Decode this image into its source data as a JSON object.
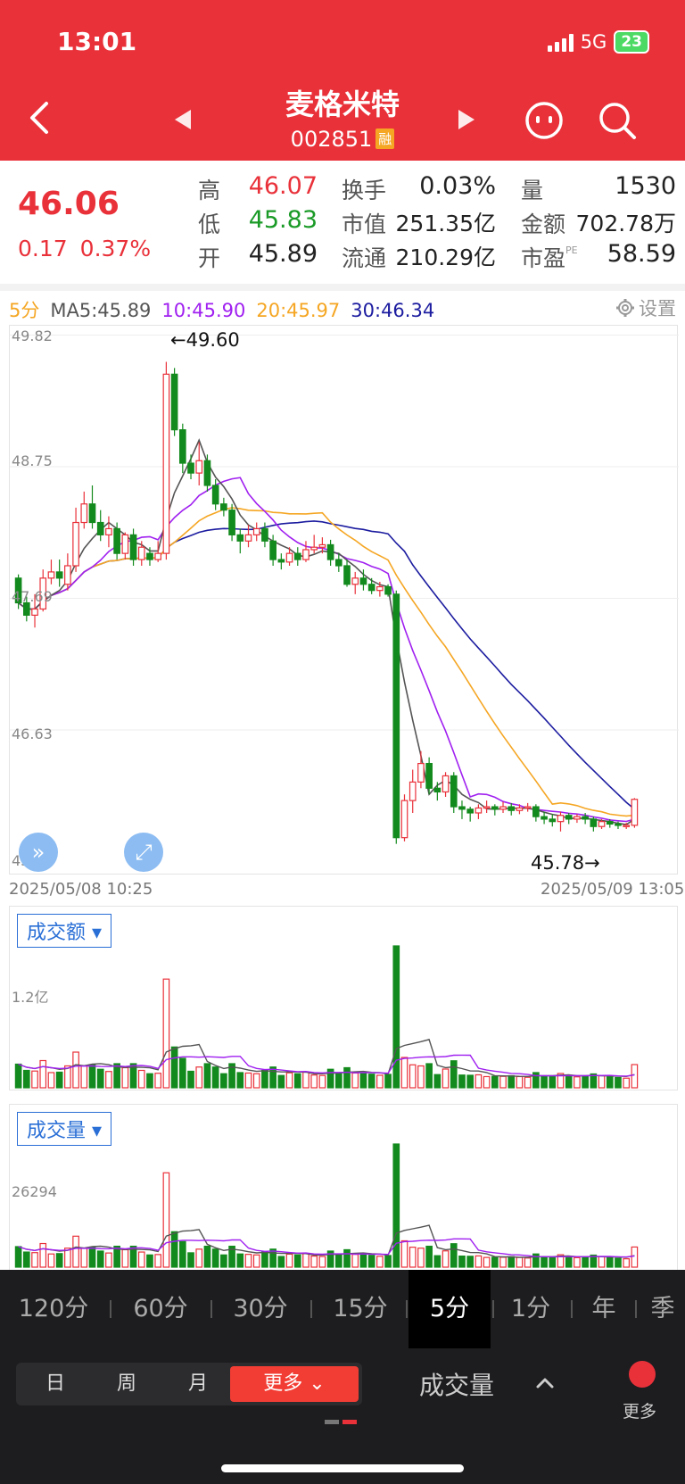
{
  "status": {
    "time": "13:01",
    "network": "5G",
    "battery": "23"
  },
  "header": {
    "name": "麦格米特",
    "code": "002851",
    "badge": "融"
  },
  "quote": {
    "price": "46.06",
    "change": "0.17",
    "change_pct": "0.37%",
    "high_label": "高",
    "high": "46.07",
    "low_label": "低",
    "low": "45.83",
    "open_label": "开",
    "open": "45.89",
    "turnover_label": "换手",
    "turnover": "0.03%",
    "mcap_label": "市值",
    "mcap": "251.35亿",
    "float_label": "流通",
    "float": "210.29亿",
    "vol_label": "量",
    "vol": "1530",
    "amount_label": "金额",
    "amount": "702.78万",
    "pe_label": "市盈",
    "pe_sup": "PE",
    "pe": "58.59"
  },
  "ma": {
    "period": "5分",
    "ma5": "MA5:45.89",
    "ma10": "10:45.90",
    "ma20": "20:45.97",
    "ma30": "30:46.34",
    "settings": "设置",
    "colors": {
      "ma5": "#555555",
      "ma10": "#a020f0",
      "ma20": "#f5a623",
      "ma30": "#1c1ca0",
      "up": "#e9313a",
      "down": "#138a1d"
    }
  },
  "chart_data": [
    {
      "type": "candlestick",
      "y_ticks": [
        "49.82",
        "48.75",
        "47.69",
        "46.63",
        "45.56"
      ],
      "ylim": [
        45.56,
        49.82
      ],
      "high_marker": "←49.60",
      "low_marker": "45.78→",
      "start_time": "2025/05/08 10:25",
      "end_time": "2025/05/09 13:05",
      "candles": [
        [
          47.85,
          47.65,
          47.88,
          47.6
        ],
        [
          47.65,
          47.55,
          47.7,
          47.5
        ],
        [
          47.55,
          47.6,
          47.72,
          47.45
        ],
        [
          47.6,
          47.85,
          47.92,
          47.58
        ],
        [
          47.85,
          47.9,
          48.0,
          47.8
        ],
        [
          47.9,
          47.85,
          48.0,
          47.78
        ],
        [
          47.8,
          47.95,
          48.05,
          47.75
        ],
        [
          47.95,
          48.3,
          48.42,
          47.9
        ],
        [
          48.3,
          48.45,
          48.55,
          48.25
        ],
        [
          48.45,
          48.3,
          48.6,
          48.25
        ],
        [
          48.3,
          48.2,
          48.4,
          48.15
        ],
        [
          48.2,
          48.25,
          48.35,
          48.1
        ],
        [
          48.25,
          48.05,
          48.3,
          48.0
        ],
        [
          48.05,
          48.2,
          48.22,
          48.0
        ],
        [
          48.2,
          48.0,
          48.25,
          47.95
        ],
        [
          48.0,
          48.1,
          48.15,
          47.95
        ],
        [
          48.05,
          48.0,
          48.1,
          47.95
        ],
        [
          48.0,
          48.05,
          48.15,
          47.98
        ],
        [
          48.05,
          49.5,
          49.6,
          48.0
        ],
        [
          49.5,
          49.05,
          49.55,
          49.0
        ],
        [
          49.05,
          48.78,
          49.1,
          48.7
        ],
        [
          48.78,
          48.7,
          48.85,
          48.65
        ],
        [
          48.7,
          48.8,
          48.95,
          48.6
        ],
        [
          48.8,
          48.6,
          48.85,
          48.55
        ],
        [
          48.6,
          48.45,
          48.65,
          48.4
        ],
        [
          48.45,
          48.4,
          48.5,
          48.35
        ],
        [
          48.4,
          48.2,
          48.45,
          48.15
        ],
        [
          48.2,
          48.15,
          48.25,
          48.05
        ],
        [
          48.15,
          48.2,
          48.28,
          48.1
        ],
        [
          48.2,
          48.25,
          48.3,
          48.15
        ],
        [
          48.25,
          48.15,
          48.3,
          48.1
        ],
        [
          48.15,
          48.0,
          48.2,
          47.95
        ],
        [
          48.0,
          47.98,
          48.05,
          47.92
        ],
        [
          47.98,
          48.05,
          48.1,
          47.95
        ],
        [
          48.05,
          48.0,
          48.1,
          47.95
        ],
        [
          48.0,
          48.08,
          48.15,
          47.98
        ],
        [
          48.08,
          48.1,
          48.2,
          48.05
        ],
        [
          48.1,
          48.12,
          48.18,
          48.05
        ],
        [
          48.12,
          48.0,
          48.16,
          47.95
        ],
        [
          48.0,
          47.95,
          48.05,
          47.9
        ],
        [
          47.95,
          47.8,
          48.0,
          47.78
        ],
        [
          47.8,
          47.85,
          47.9,
          47.72
        ],
        [
          47.85,
          47.8,
          47.92,
          47.75
        ],
        [
          47.8,
          47.75,
          47.85,
          47.72
        ],
        [
          47.75,
          47.78,
          47.82,
          47.7
        ],
        [
          47.78,
          47.72,
          47.8,
          47.7
        ],
        [
          47.72,
          45.75,
          47.75,
          45.7
        ],
        [
          45.75,
          46.05,
          46.1,
          45.72
        ],
        [
          46.05,
          46.2,
          46.3,
          45.95
        ],
        [
          46.2,
          46.35,
          46.45,
          46.15
        ],
        [
          46.35,
          46.15,
          46.4,
          46.1
        ],
        [
          46.15,
          46.12,
          46.2,
          46.05
        ],
        [
          46.12,
          46.25,
          46.28,
          46.08
        ],
        [
          46.25,
          46.0,
          46.28,
          45.95
        ],
        [
          46.0,
          45.98,
          46.05,
          45.9
        ],
        [
          45.98,
          45.95,
          46.0,
          45.88
        ],
        [
          45.95,
          45.99,
          46.02,
          45.9
        ],
        [
          45.99,
          46.0,
          46.05,
          45.95
        ],
        [
          46.0,
          45.98,
          46.02,
          45.93
        ],
        [
          45.98,
          46.0,
          46.04,
          45.95
        ],
        [
          46.0,
          45.97,
          46.03,
          45.93
        ],
        [
          45.97,
          45.99,
          46.02,
          45.94
        ],
        [
          45.99,
          46.0,
          46.03,
          45.96
        ],
        [
          46.0,
          45.92,
          46.02,
          45.88
        ],
        [
          45.92,
          45.9,
          45.96,
          45.86
        ],
        [
          45.9,
          45.88,
          45.94,
          45.84
        ],
        [
          45.88,
          45.93,
          45.96,
          45.8
        ],
        [
          45.93,
          45.9,
          45.95,
          45.86
        ],
        [
          45.9,
          45.92,
          45.94,
          45.87
        ],
        [
          45.92,
          45.9,
          45.95,
          45.86
        ],
        [
          45.9,
          45.84,
          45.92,
          45.8
        ],
        [
          45.84,
          45.88,
          45.9,
          45.82
        ],
        [
          45.88,
          45.86,
          45.9,
          45.83
        ],
        [
          45.86,
          45.85,
          45.88,
          45.82
        ],
        [
          45.85,
          45.85,
          45.87,
          45.82
        ],
        [
          45.85,
          46.06,
          46.07,
          45.83
        ]
      ]
    },
    {
      "type": "bar",
      "name": "成交额",
      "y_tick": "1.2亿",
      "ymax": 1.6,
      "unit": "亿"
    },
    {
      "type": "bar",
      "name": "成交量",
      "y_tick": "26294",
      "ymax": 37000
    }
  ],
  "amount_tab": "成交额",
  "volume_tab": "成交量",
  "periods": [
    "120分",
    "60分",
    "30分",
    "15分",
    "5分",
    "1分",
    "年",
    "季"
  ],
  "active_period": "5分",
  "range_tabs": [
    "日",
    "周",
    "月",
    "更多"
  ],
  "indicator_label": "成交量",
  "more_label": "更多"
}
